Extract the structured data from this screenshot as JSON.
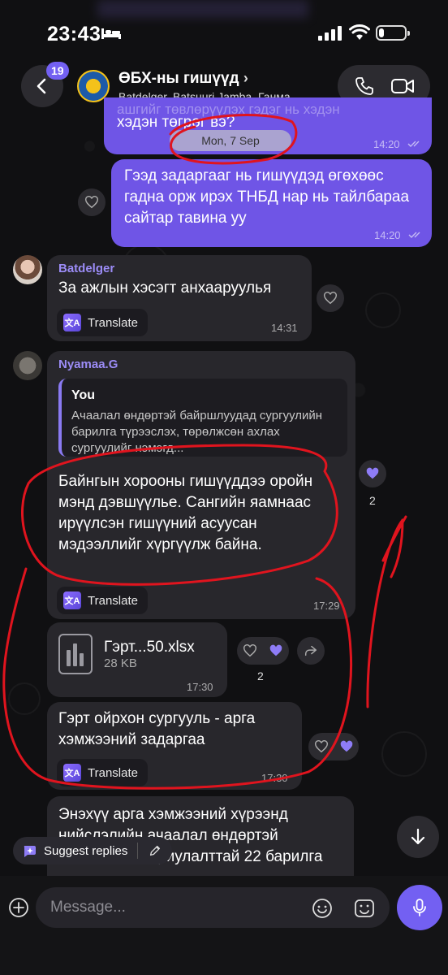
{
  "status": {
    "time": "23:43",
    "battery_level": 0.2
  },
  "header": {
    "unread_count": "19",
    "title": "ӨБХ-ны гишүүд",
    "subtitle": "Batdelger, Batsuuri Jamba, Ганма..."
  },
  "date_pill": "Mon, 7 Sep",
  "messages": {
    "m1": {
      "text_top": "ашгийг төвлөрүүлэх гэдэг нь хэдэн",
      "text": "хэдэн төгрөг вэ?",
      "time": "14:20"
    },
    "m2": {
      "text": "Гээд задаргааг нь гишүүдэд өгөхөөс гадна орж ирэх ТНБД нар нь тайлбараа сайтар тавина уу",
      "time": "14:20"
    },
    "m3": {
      "sender": "Batdelger",
      "text": "За ажлын хэсэгт анхааруулья",
      "translate": "Translate",
      "time": "14:31"
    },
    "m4": {
      "sender": "Nyamaa.G",
      "quote_name": "You",
      "quote_text": "Ачаалал өндөртэй байршлуудад сургуулийн барилга түрээслэх, төрөлжсөн ахлах сургуулийг нэмэгд...",
      "text": "Байнгын хорооны гишүүддээ оройн мэнд дэвшүүлье. Сангийн яамнаас ирүүлсэн гишүүний асуусан мэдээллийг хүргүүлж байна.",
      "translate": "Translate",
      "time": "17:29",
      "reaction_count": "2"
    },
    "m5": {
      "file_name": "Гэрт...50.xlsx",
      "file_size": "28 KB",
      "time": "17:30",
      "reaction_count": "2"
    },
    "m6": {
      "text": "Гэрт ойрхон сургууль - арга хэмжээний задаргаа",
      "translate": "Translate",
      "time": "17:30"
    },
    "m7": {
      "text": "Энэхүү арга хэмжээний хүрээнд нийслэлийн ачаалал өндөртэй сургуулийн зориулалттай 22 барилга"
    }
  },
  "suggest_replies": "Suggest replies",
  "composer": {
    "placeholder": "Message..."
  },
  "colors": {
    "accent": "#7360f2",
    "outgoing": "#6f55e6",
    "incoming": "#28272c",
    "annotation": "#e0141e"
  }
}
